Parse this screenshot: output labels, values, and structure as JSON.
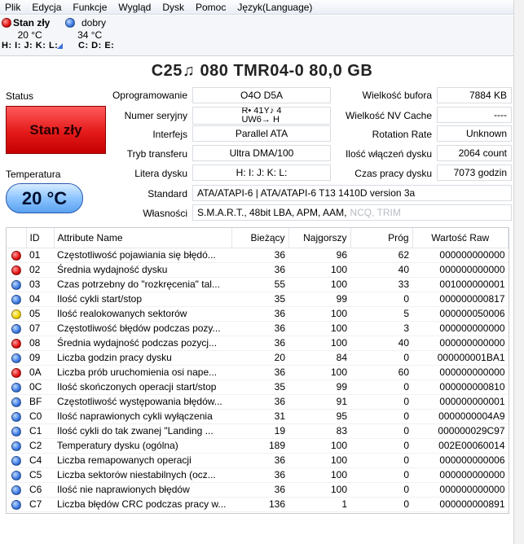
{
  "menu": [
    "Plik",
    "Edycja",
    "Funkcje",
    "Wygląd",
    "Dysk",
    "Pomoc",
    "Język(Language)"
  ],
  "drives": [
    {
      "status": "Stan zły",
      "temp": "20 °C",
      "letters": "H: I: J: K: L:",
      "color": "red",
      "selected": true
    },
    {
      "status": "dobry",
      "temp": "34 °C",
      "letters": "C: D: E:",
      "color": "blue",
      "selected": false
    }
  ],
  "disk": {
    "title": "C25♫ 080   TMR04-0   80,0 GB",
    "status_label": "Status",
    "status_value": "Stan zły",
    "temp_label": "Temperatura",
    "temp_value": "20 °C"
  },
  "info": {
    "firmware_label": "Oprogramowanie",
    "firmware_value": "O4O  D5A",
    "serial_label": "Numer seryjny",
    "serial_value": "R• 41Y♪ 4\nUW6→ H",
    "interface_label": "Interfejs",
    "interface_value": "Parallel ATA",
    "transfer_label": "Tryb transferu",
    "transfer_value": "Ultra DMA/100",
    "drive_letter_label": "Litera dysku",
    "drive_letter_value": "H: I: J: K: L:",
    "standard_label": "Standard",
    "standard_value": "ATA/ATAPI-6 | ATA/ATAPI-6 T13 1410D version 3a",
    "features_label": "Własności",
    "features_value": "S.M.A.R.T., 48bit LBA, APM, AAM,",
    "features_disabled": "NCQ, TRIM",
    "buffer_label": "Wielkość bufora",
    "buffer_value": "7884 KB",
    "nvcache_label": "Wielkość NV Cache",
    "nvcache_value": "----",
    "rotation_label": "Rotation Rate",
    "rotation_value": "Unknown",
    "power_count_label": "Ilość włączeń dysku",
    "power_count_value": "2064 count",
    "power_hours_label": "Czas pracy dysku",
    "power_hours_value": "7073 godzin"
  },
  "table": {
    "headers": [
      "ID",
      "Attribute Name",
      "Bieżący",
      "Najgorszy",
      "Próg",
      "Wartość Raw"
    ],
    "rows": [
      {
        "color": "red",
        "id": "01",
        "name": "Częstotliwość pojawiania się błędó...",
        "current": "36",
        "worst": "96",
        "threshold": "62",
        "raw": "000000000000"
      },
      {
        "color": "red",
        "id": "02",
        "name": "Średnia wydajność dysku",
        "current": "36",
        "worst": "100",
        "threshold": "40",
        "raw": "000000000000"
      },
      {
        "color": "blue",
        "id": "03",
        "name": "Czas potrzebny do \"rozkręcenia\" tal...",
        "current": "55",
        "worst": "100",
        "threshold": "33",
        "raw": "001000000001"
      },
      {
        "color": "blue",
        "id": "04",
        "name": "Ilość cykli start/stop",
        "current": "35",
        "worst": "99",
        "threshold": "0",
        "raw": "000000000817"
      },
      {
        "color": "yellow",
        "id": "05",
        "name": "Ilość realokowanych sektorów",
        "current": "36",
        "worst": "100",
        "threshold": "5",
        "raw": "000000050006"
      },
      {
        "color": "blue",
        "id": "07",
        "name": "Częstotliwość błędów podczas pozy...",
        "current": "36",
        "worst": "100",
        "threshold": "3",
        "raw": "000000000000"
      },
      {
        "color": "red",
        "id": "08",
        "name": "Średnia wydajność podczas pozycj...",
        "current": "36",
        "worst": "100",
        "threshold": "40",
        "raw": "000000000000"
      },
      {
        "color": "blue",
        "id": "09",
        "name": "Liczba godzin pracy dysku",
        "current": "20",
        "worst": "84",
        "threshold": "0",
        "raw": "000000001BA1"
      },
      {
        "color": "red",
        "id": "0A",
        "name": "Liczba prób uruchomienia osi nape...",
        "current": "36",
        "worst": "100",
        "threshold": "60",
        "raw": "000000000000"
      },
      {
        "color": "blue",
        "id": "0C",
        "name": "Ilość skończonych operacji start/stop",
        "current": "35",
        "worst": "99",
        "threshold": "0",
        "raw": "000000000810"
      },
      {
        "color": "blue",
        "id": "BF",
        "name": "Częstotliwość występowania błędów...",
        "current": "36",
        "worst": "91",
        "threshold": "0",
        "raw": "000000000001"
      },
      {
        "color": "blue",
        "id": "C0",
        "name": "Ilość naprawionych cykli wyłączenia",
        "current": "31",
        "worst": "95",
        "threshold": "0",
        "raw": "0000000004A9"
      },
      {
        "color": "blue",
        "id": "C1",
        "name": "Ilość cykli do tak zwanej \"Landing ...",
        "current": "19",
        "worst": "83",
        "threshold": "0",
        "raw": "000000029C97"
      },
      {
        "color": "blue",
        "id": "C2",
        "name": "Temperatury dysku (ogólna)",
        "current": "189",
        "worst": "100",
        "threshold": "0",
        "raw": "002E00060014"
      },
      {
        "color": "blue",
        "id": "C4",
        "name": "Liczba remapowanych operacji",
        "current": "36",
        "worst": "100",
        "threshold": "0",
        "raw": "000000000006"
      },
      {
        "color": "blue",
        "id": "C5",
        "name": "Liczba sektorów niestabilnych (ocz...",
        "current": "36",
        "worst": "100",
        "threshold": "0",
        "raw": "000000000000"
      },
      {
        "color": "blue",
        "id": "C6",
        "name": "Ilość nie naprawionych błędów",
        "current": "36",
        "worst": "100",
        "threshold": "0",
        "raw": "000000000000"
      },
      {
        "color": "blue",
        "id": "C7",
        "name": "Liczba błędów CRC podczas pracy w...",
        "current": "136",
        "worst": "1",
        "threshold": "0",
        "raw": "000000000891"
      }
    ]
  }
}
